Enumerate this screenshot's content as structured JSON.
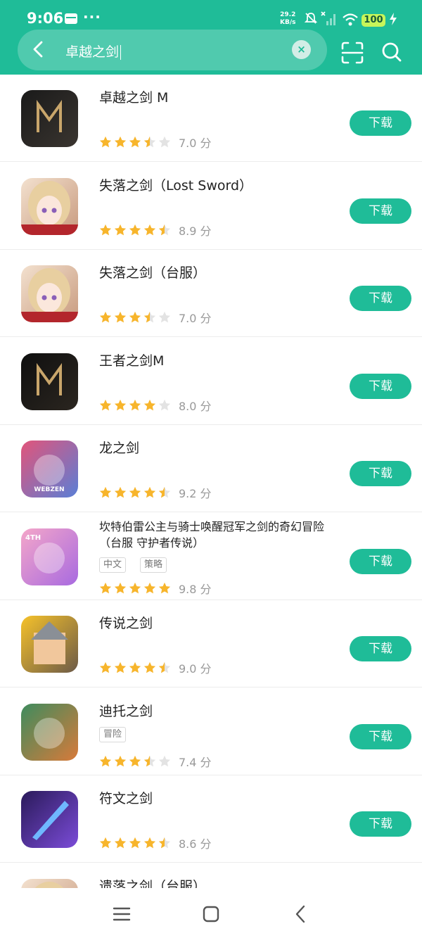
{
  "status_bar": {
    "time": "9:06",
    "more": "···",
    "net_speed_value": "29.2",
    "net_speed_unit": "KB/s",
    "battery": "100"
  },
  "search": {
    "query": "卓越之剑",
    "clear_icon": "×"
  },
  "colors": {
    "brand": "#1fbc98",
    "star_on": "#f7b52c",
    "star_off": "#e3e3e3"
  },
  "download_label": "下载",
  "apps": [
    {
      "name": "卓越之剑 M",
      "rating": 3.5,
      "score": "7.0 分",
      "tags": [],
      "icon": "grande-espada-icon"
    },
    {
      "name": "失落之剑（Lost Sword）",
      "rating": 4.5,
      "score": "8.9 分",
      "tags": [],
      "icon": "lost-sword-icon"
    },
    {
      "name": "失落之剑（台服）",
      "rating": 3.5,
      "score": "7.0 分",
      "tags": [],
      "icon": "lost-sword-tw-icon"
    },
    {
      "name": "王者之剑M",
      "rating": 4,
      "score": "8.0 分",
      "tags": [],
      "icon": "king-sword-icon"
    },
    {
      "name": "龙之剑",
      "rating": 4.5,
      "score": "9.2 分",
      "tags": [],
      "icon": "dragon-sword-icon",
      "icon_text": "WEBZEN"
    },
    {
      "name": "坎特伯雷公主与骑士唤醒冠军之剑的奇幻冒险（台服 守护者传说）",
      "rating": 5,
      "score": "9.8 分",
      "tags": [
        "中文",
        "策略"
      ],
      "icon": "guardian-tales-icon",
      "icon_text": "4TH"
    },
    {
      "name": "传说之剑",
      "rating": 4.5,
      "score": "9.0 分",
      "tags": [],
      "icon": "legend-sword-icon"
    },
    {
      "name": "迪托之剑",
      "rating": 3.5,
      "score": "7.4 分",
      "tags": [
        "冒险"
      ],
      "icon": "ditto-sword-icon"
    },
    {
      "name": "符文之剑",
      "rating": 4.5,
      "score": "8.6 分",
      "tags": [],
      "icon": "rune-sword-icon"
    },
    {
      "name": "遗落之剑（台服）",
      "rating": 0,
      "score": "",
      "tags": [],
      "icon": "lost-sword-tw2-icon"
    }
  ]
}
